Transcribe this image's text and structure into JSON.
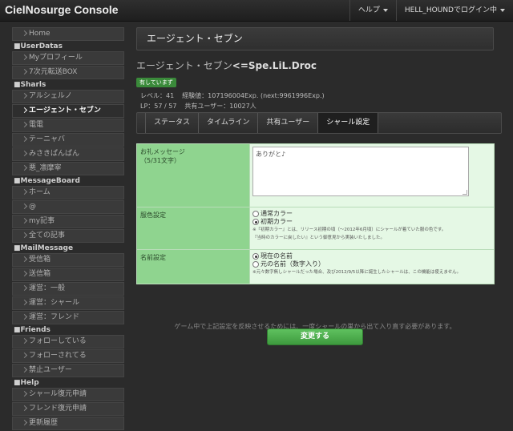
{
  "app": {
    "title": "CielNosurge Console"
  },
  "topnav": {
    "help": "ヘルプ",
    "user": "HELL_HOUNDでログイン中"
  },
  "sidebar": [
    {
      "type": "link",
      "label": "Home"
    },
    {
      "type": "head",
      "label": "■UserDatas"
    },
    {
      "type": "link",
      "label": "Myプロフィール"
    },
    {
      "type": "link",
      "label": "7次元転送BOX"
    },
    {
      "type": "head",
      "label": "■Sharls"
    },
    {
      "type": "link",
      "label": "アルシェルノ"
    },
    {
      "type": "link",
      "label": "エージェント・セブン",
      "active": true
    },
    {
      "type": "link",
      "label": "電電"
    },
    {
      "type": "link",
      "label": "テーニャバ"
    },
    {
      "type": "link",
      "label": "みさきぱんぱん"
    },
    {
      "type": "link",
      "label": "悪_凛摩宰"
    },
    {
      "type": "head",
      "label": "■MessageBoard"
    },
    {
      "type": "link",
      "label": "ホーム"
    },
    {
      "type": "link",
      "label": "@"
    },
    {
      "type": "link",
      "label": "my記事"
    },
    {
      "type": "link",
      "label": "全ての記事"
    },
    {
      "type": "head",
      "label": "■MailMessage"
    },
    {
      "type": "link",
      "label": "受信箱"
    },
    {
      "type": "link",
      "label": "送信箱"
    },
    {
      "type": "link",
      "label": "運営：一般"
    },
    {
      "type": "link",
      "label": "運営：シャール"
    },
    {
      "type": "link",
      "label": "運営：フレンド"
    },
    {
      "type": "head",
      "label": "■Friends"
    },
    {
      "type": "link",
      "label": "フォローしている"
    },
    {
      "type": "link",
      "label": "フォローされてる"
    },
    {
      "type": "link",
      "label": "禁止ユーザー"
    },
    {
      "type": "head",
      "label": "■Help"
    },
    {
      "type": "link",
      "label": "シャール復元申請"
    },
    {
      "type": "link",
      "label": "フレンド復元申請"
    },
    {
      "type": "link",
      "label": "更新履歴"
    }
  ],
  "main": {
    "page_title": "エージェント・セブン",
    "unit_name": "エージェント・セブン",
    "unit_suffix": "<=Spe.LiL.Droc",
    "badge": "有していまず",
    "level": "レベル：41",
    "exp": "経験値：107196004Exp. (next:9961996Exp.)",
    "lp": "LP：57 / 57",
    "shared_users": "共有ユーザー：10027人",
    "tabs": [
      "ステータス",
      "タイムライン",
      "共有ユーザー",
      "シャール設定"
    ],
    "active_tab": 3
  },
  "form": {
    "message_label": "お礼メッセージ\n（5/31文字）",
    "message_value": "ありがと♪",
    "color_label": "服色設定",
    "color_options": [
      "通常カラー",
      "初期カラー"
    ],
    "color_selected": 1,
    "color_note1": "※『初期カラー』とは、リリース初期の頃（〜2012年6月頃）にシャールが着ていた服の色です。",
    "color_note2": "『当時のカラーに戻したい』という御意見から実装いたしました。",
    "name_label": "名前設定",
    "name_options": [
      "現在の名前",
      "元の名前（数字入り）"
    ],
    "name_selected": 0,
    "name_note": "※元々数字無しシャールだった場合、及び2012/9/5以降に誕生したシャールは、この機能は使えません。",
    "footnote": "ゲーム中で上記設定を反映させるためには、一度シャールの巣から出て入り直す必要があります。",
    "submit": "変更する"
  },
  "colors": {
    "accent_green": "#4cae4c",
    "label_green": "#8fd48f",
    "field_green": "#e5f8e5"
  }
}
